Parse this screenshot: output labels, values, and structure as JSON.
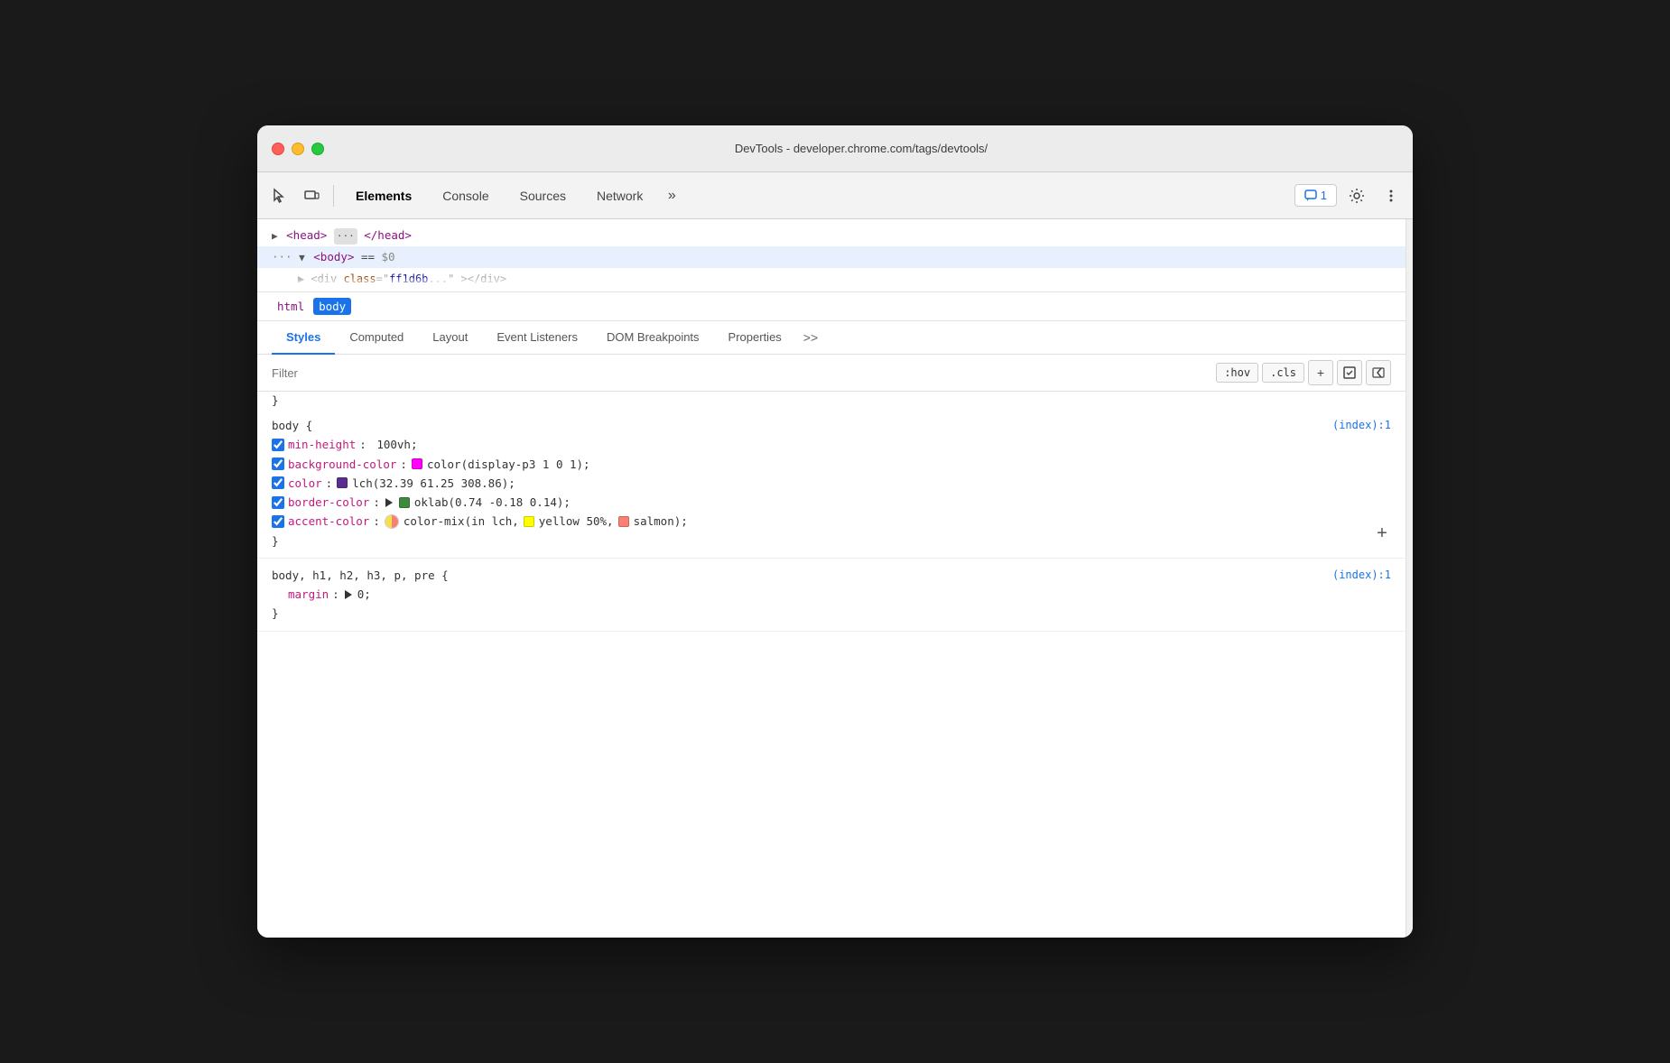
{
  "window": {
    "title": "DevTools - developer.chrome.com/tags/devtools/"
  },
  "toolbar": {
    "tabs": [
      {
        "id": "elements",
        "label": "Elements",
        "active": true
      },
      {
        "id": "console",
        "label": "Console",
        "active": false
      },
      {
        "id": "sources",
        "label": "Sources",
        "active": false
      },
      {
        "id": "network",
        "label": "Network",
        "active": false
      }
    ],
    "more_label": "»",
    "notification_count": "1",
    "settings_title": "Settings",
    "more_vert_title": "More options"
  },
  "elements_panel": {
    "head_line": "▶  <head> ··· </head>",
    "body_line": "···▼ <body> == $0"
  },
  "breadcrumb": {
    "items": [
      {
        "id": "html",
        "label": "html",
        "active": false
      },
      {
        "id": "body",
        "label": "body",
        "active": true
      }
    ]
  },
  "styles_tabs": {
    "tabs": [
      {
        "id": "styles",
        "label": "Styles",
        "active": true
      },
      {
        "id": "computed",
        "label": "Computed",
        "active": false
      },
      {
        "id": "layout",
        "label": "Layout",
        "active": false
      },
      {
        "id": "event-listeners",
        "label": "Event Listeners",
        "active": false
      },
      {
        "id": "dom-breakpoints",
        "label": "DOM Breakpoints",
        "active": false
      },
      {
        "id": "properties",
        "label": "Properties",
        "active": false
      }
    ],
    "more_label": ">>"
  },
  "filter": {
    "placeholder": "Filter",
    "hov_label": ":hov",
    "cls_label": ".cls",
    "add_label": "+"
  },
  "css_rules": [
    {
      "id": "body-rule",
      "selector": "body {",
      "source": "(index):1",
      "closing": "}",
      "properties": [
        {
          "id": "min-height",
          "checked": true,
          "name": "min-height",
          "value": "100vh;",
          "has_swatch": false
        },
        {
          "id": "background-color",
          "checked": true,
          "name": "background-color",
          "value": "color(display-p3 1 0 1);",
          "has_swatch": true,
          "swatch_color": "#ff00ff"
        },
        {
          "id": "color",
          "checked": true,
          "name": "color",
          "value": "lch(32.39 61.25 308.86);",
          "has_swatch": true,
          "swatch_color": "#5c2d91"
        },
        {
          "id": "border-color",
          "checked": true,
          "name": "border-color",
          "value": "oklab(0.74 -0.18 0.14);",
          "has_swatch": true,
          "swatch_color": "#3d8a3d",
          "has_triangle": true
        },
        {
          "id": "accent-color",
          "checked": true,
          "name": "accent-color",
          "value": "color-mix(in lch,",
          "value2": "yellow 50%,",
          "value3": "salmon);",
          "has_color_mix": true,
          "mix_color1": "#f4e04d",
          "mix_color2": "#fa8072",
          "mix_preview": "#e8a050"
        }
      ]
    },
    {
      "id": "body-h1-rule",
      "selector": "body, h1, h2, h3, p, pre {",
      "source": "(index):1",
      "closing": "}",
      "properties": [
        {
          "id": "margin",
          "checked": false,
          "name": "margin",
          "value": "0;",
          "has_triangle": true
        }
      ]
    }
  ],
  "icons": {
    "cursor": "⬚",
    "device": "▭",
    "notification": "💬",
    "settings": "⚙",
    "more_vert": "⋮",
    "add": "+",
    "filter_new": "+",
    "toggle_sidebar": "◁",
    "force_element": "⊡"
  }
}
